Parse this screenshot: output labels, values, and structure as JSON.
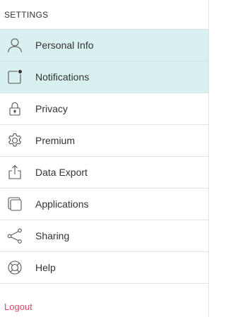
{
  "header": {
    "title": "SETTINGS"
  },
  "menu": {
    "items": [
      {
        "id": "personal-info",
        "label": "Personal Info",
        "icon": "user-icon",
        "active": true
      },
      {
        "id": "notifications",
        "label": "Notifications",
        "icon": "notification-icon",
        "active": true
      },
      {
        "id": "privacy",
        "label": "Privacy",
        "icon": "lock-icon",
        "active": false
      },
      {
        "id": "premium",
        "label": "Premium",
        "icon": "gear-icon",
        "active": false
      },
      {
        "id": "data-export",
        "label": "Data Export",
        "icon": "export-icon",
        "active": false
      },
      {
        "id": "applications",
        "label": "Applications",
        "icon": "apps-icon",
        "active": false
      },
      {
        "id": "sharing",
        "label": "Sharing",
        "icon": "share-icon",
        "active": false
      },
      {
        "id": "help",
        "label": "Help",
        "icon": "lifebuoy-icon",
        "active": false
      }
    ]
  },
  "footer": {
    "logout_label": "Logout"
  },
  "colors": {
    "active_background": "#d9f0f1",
    "text": "#333333",
    "icon_stroke": "#555555",
    "logout": "#d9486a",
    "divider": "#e2e2e2"
  }
}
